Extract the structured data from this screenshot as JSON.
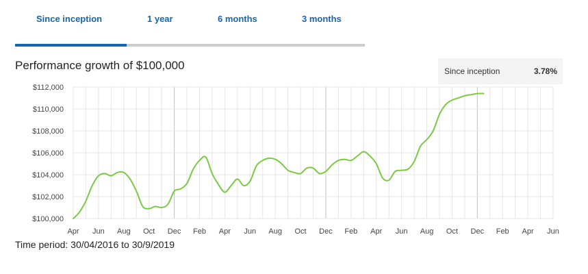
{
  "tabs": [
    {
      "label": "Since inception",
      "active": true
    },
    {
      "label": "1 year",
      "active": false
    },
    {
      "label": "6 months",
      "active": false
    },
    {
      "label": "3 months",
      "active": false
    }
  ],
  "summary": {
    "label": "Since inception",
    "value": "3.78%"
  },
  "time_period": "Time period: 30/04/2016 to 30/9/2019",
  "colors": {
    "accent": "#1565b0",
    "line": "#7ac943",
    "grid": "#e4e4e4",
    "grid_major": "#bfbfbf"
  },
  "chart_data": {
    "type": "line",
    "title": "Performance growth of $100,000",
    "xlabel": "",
    "ylabel": "",
    "ylim": [
      100000,
      112000
    ],
    "yticks": [
      100000,
      102000,
      104000,
      106000,
      108000,
      110000,
      112000
    ],
    "ytick_labels": [
      "$100,000",
      "$102,000",
      "$104,000",
      "$106,000",
      "$108,000",
      "$110,000",
      "$112,000"
    ],
    "xtick_labels": [
      "Apr",
      "Jun",
      "Aug",
      "Oct",
      "Dec",
      "Feb",
      "Apr",
      "Jun",
      "Aug",
      "Oct",
      "Dec",
      "Feb",
      "Apr",
      "Jun",
      "Aug",
      "Oct",
      "Dec",
      "Feb",
      "Apr",
      "Jun"
    ],
    "grid": true,
    "legend": "none",
    "series": [
      {
        "values": [
          [
            0,
            100000
          ],
          [
            0.5,
            100600
          ],
          [
            1,
            101600
          ],
          [
            1.5,
            103000
          ],
          [
            2,
            103900
          ],
          [
            2.5,
            104100
          ],
          [
            3,
            103900
          ],
          [
            3.5,
            104200
          ],
          [
            4,
            104200
          ],
          [
            4.5,
            103600
          ],
          [
            5,
            102500
          ],
          [
            5.5,
            101100
          ],
          [
            6,
            100900
          ],
          [
            6.5,
            101100
          ],
          [
            7,
            101000
          ],
          [
            7.5,
            101300
          ],
          [
            8,
            102500
          ],
          [
            8.5,
            102700
          ],
          [
            9,
            103200
          ],
          [
            9.5,
            104500
          ],
          [
            10,
            105300
          ],
          [
            10.5,
            105600
          ],
          [
            11,
            104100
          ],
          [
            11.5,
            103100
          ],
          [
            12,
            102400
          ],
          [
            12.5,
            103000
          ],
          [
            13,
            103600
          ],
          [
            13.5,
            103000
          ],
          [
            14,
            103400
          ],
          [
            14.5,
            104800
          ],
          [
            15,
            105300
          ],
          [
            15.5,
            105500
          ],
          [
            16,
            105400
          ],
          [
            16.5,
            105000
          ],
          [
            17,
            104400
          ],
          [
            17.5,
            104200
          ],
          [
            18,
            104100
          ],
          [
            18.5,
            104600
          ],
          [
            19,
            104600
          ],
          [
            19.5,
            104100
          ],
          [
            20,
            104300
          ],
          [
            20.5,
            104900
          ],
          [
            21,
            105300
          ],
          [
            21.5,
            105400
          ],
          [
            22,
            105300
          ],
          [
            22.5,
            105700
          ],
          [
            23,
            106100
          ],
          [
            23.5,
            105700
          ],
          [
            24,
            105000
          ],
          [
            24.5,
            103700
          ],
          [
            25,
            103500
          ],
          [
            25.5,
            104300
          ],
          [
            26,
            104400
          ],
          [
            26.5,
            104500
          ],
          [
            27,
            105200
          ],
          [
            27.5,
            106600
          ],
          [
            28,
            107200
          ],
          [
            28.5,
            108000
          ],
          [
            29,
            109500
          ],
          [
            29.5,
            110400
          ],
          [
            30,
            110800
          ],
          [
            30.5,
            111000
          ],
          [
            31,
            111200
          ],
          [
            31.5,
            111300
          ],
          [
            32,
            111400
          ],
          [
            32.5,
            111400
          ]
        ]
      }
    ]
  }
}
